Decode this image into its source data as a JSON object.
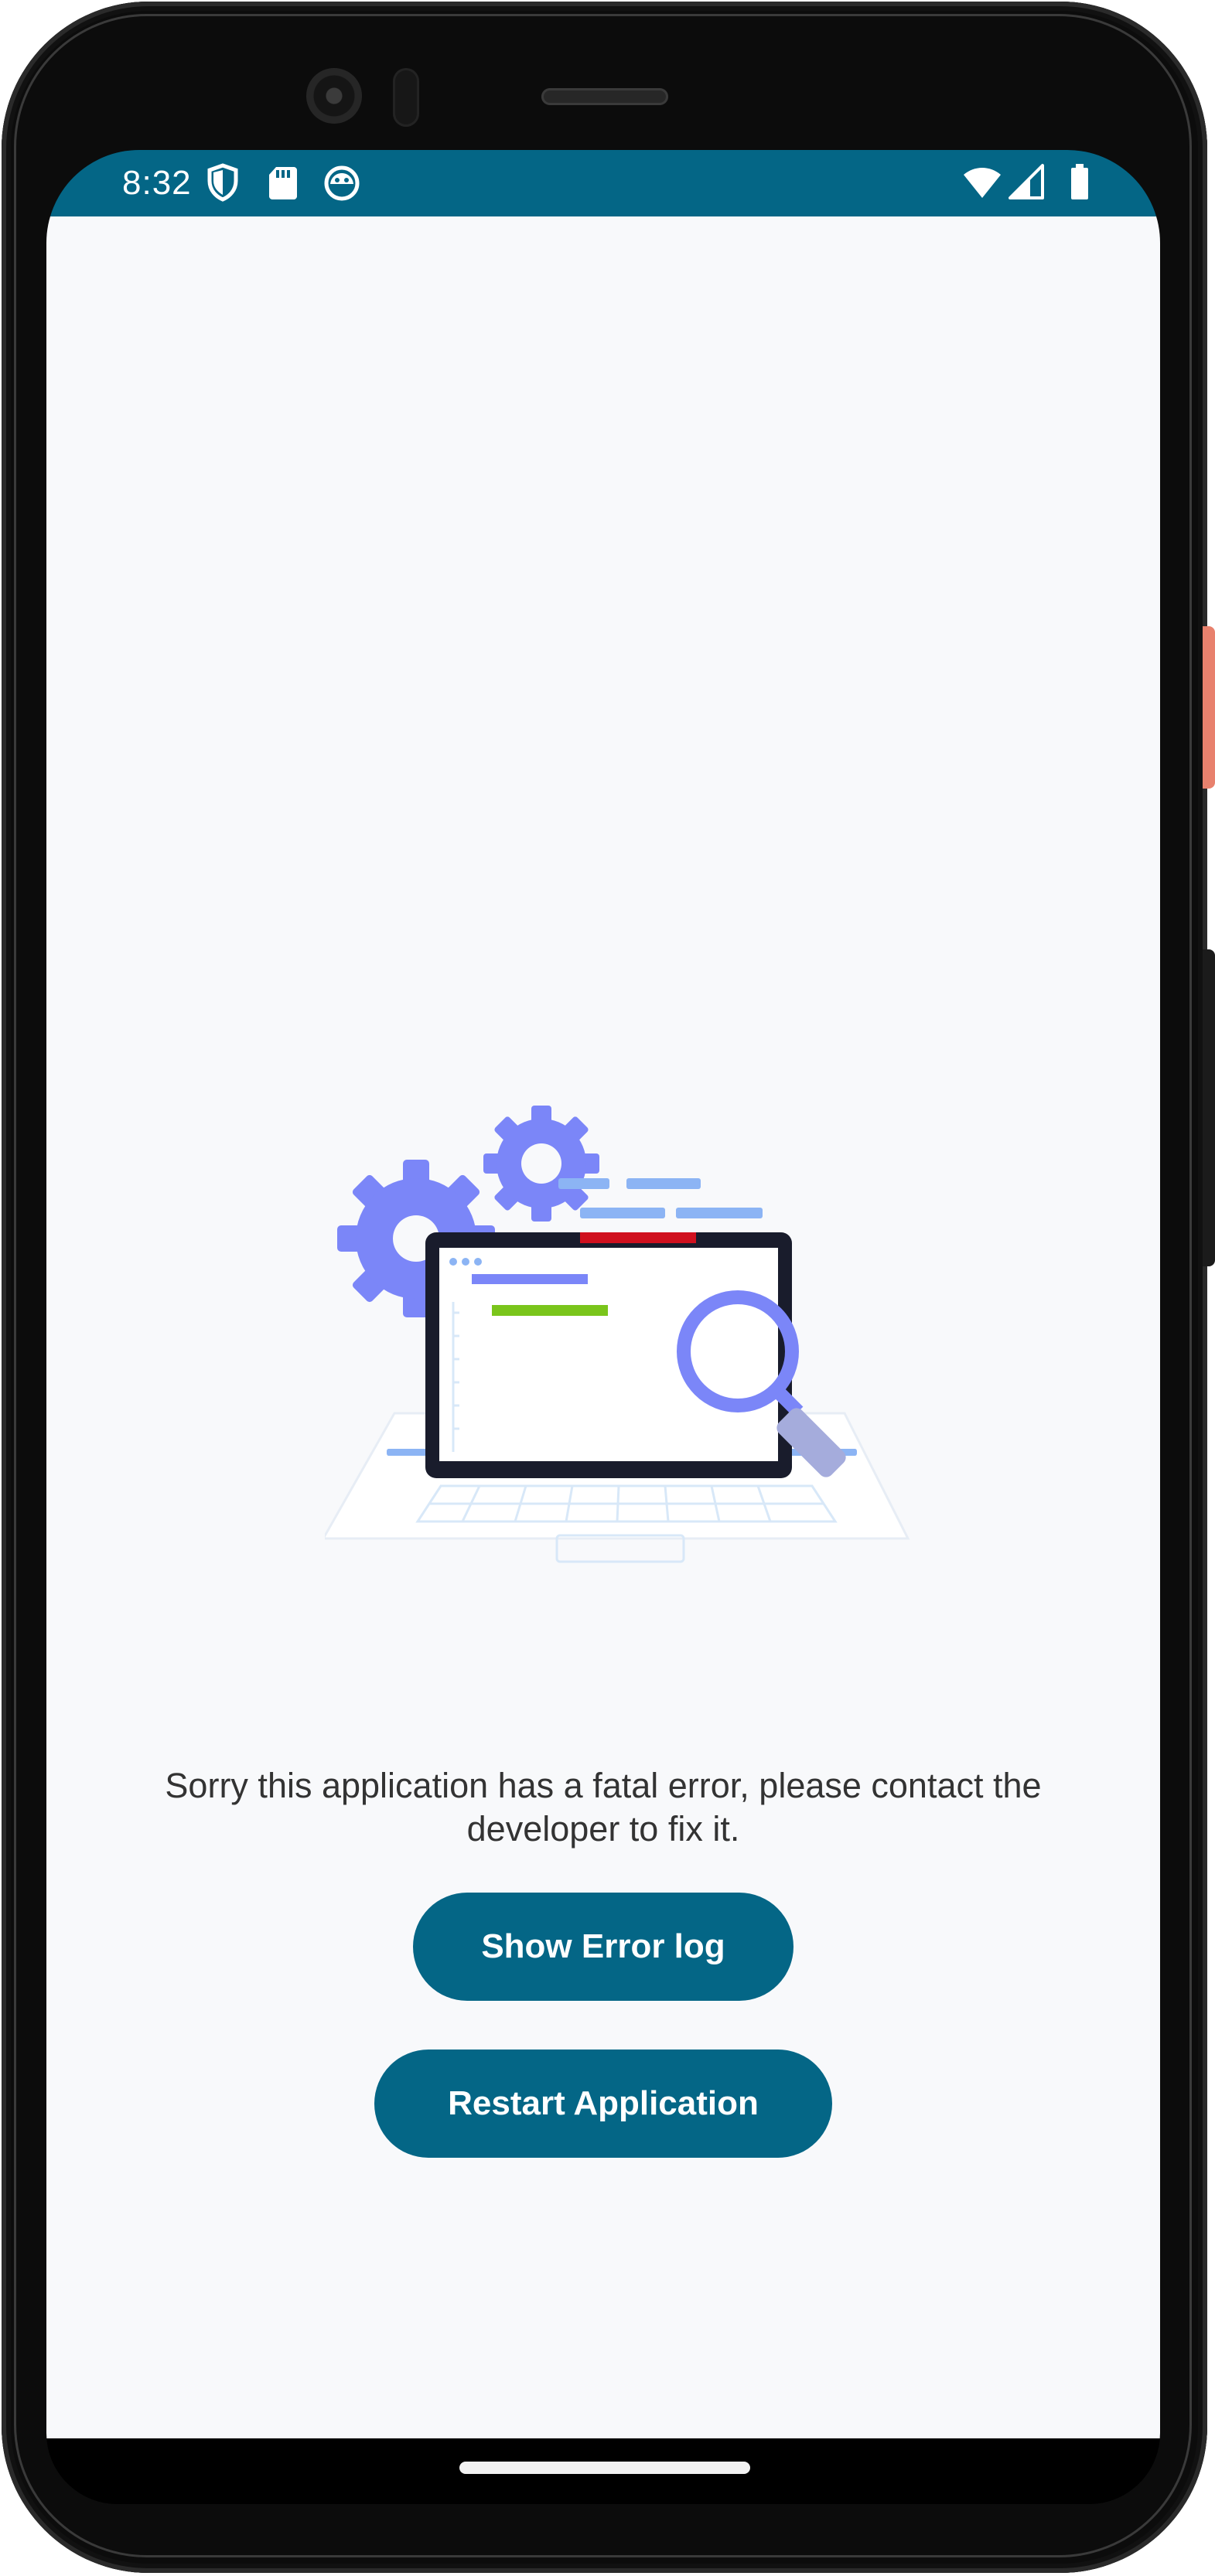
{
  "status_bar": {
    "time": "8:32",
    "left_icons": [
      "shield-icon",
      "sd-card-icon",
      "android-debug-icon"
    ],
    "right_icons": [
      "wifi-icon",
      "cell-signal-icon",
      "battery-icon"
    ],
    "background": "#046686"
  },
  "error_screen": {
    "message": "Sorry this application has a fatal error, please contact the developer to fix it.",
    "show_log_label": "Show Error log",
    "restart_label": "Restart Application"
  },
  "colors": {
    "accent": "#046686",
    "background": "#f8f9fb",
    "text": "#333333",
    "gear": "#7b86f8",
    "error_bar": "#d0101e",
    "success_bar": "#7ac51b"
  }
}
